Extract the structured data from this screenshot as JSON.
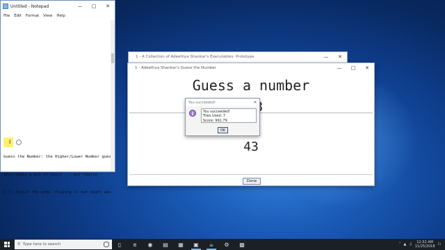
{
  "notepad": {
    "title": "Untitled - Notepad",
    "menu": [
      "File",
      "Edit",
      "Format",
      "View",
      "Help"
    ],
    "lines": [
      "Guess the Number: the Higher/Lower Number gues",
      "This takes a bit of skill ... not really",
      "I'll finish the game. Playing it out might was"
    ]
  },
  "collection_window": {
    "title": "1 - A Collection of Adeethya Shankar's Executables: Prototype"
  },
  "game_window": {
    "title": "1 - Adeethya Shankar's Guess the Number",
    "heading": "Guess a number",
    "target_number": "123",
    "current_guess": "43",
    "done_label": "Done"
  },
  "dialog": {
    "title": "You succeeded!",
    "lines": [
      "You succeeded!",
      "Tries Used: 7",
      "Score: 991.79"
    ],
    "ok_label": "OK"
  },
  "taskbar": {
    "search_placeholder": "Type here to search",
    "time": "12:32 AM",
    "date": "11/25/2018"
  }
}
